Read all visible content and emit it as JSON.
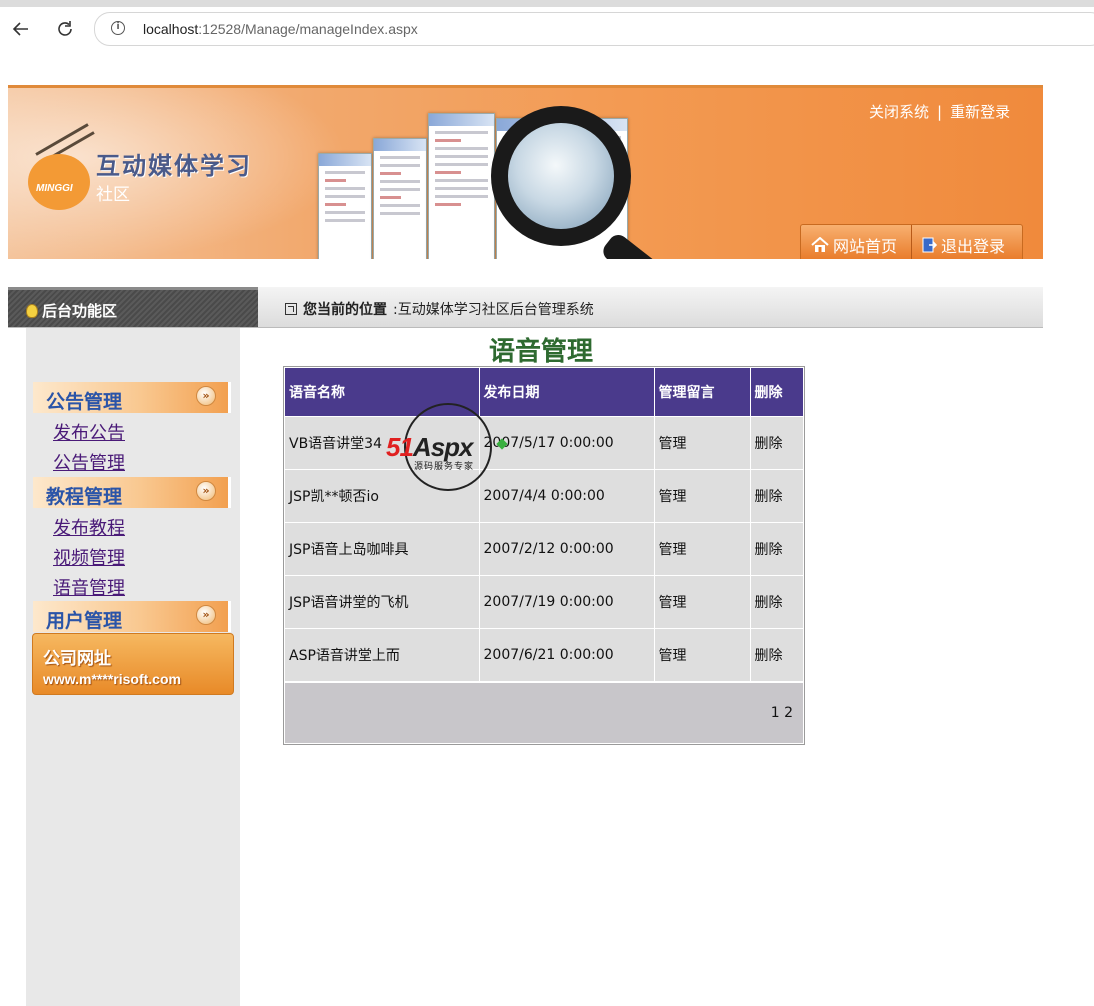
{
  "browser": {
    "url_host": "localhost",
    "url_path": ":12528/Manage/manageIndex.aspx"
  },
  "header": {
    "brand": "互动媒体学习",
    "brand_sub": "社区",
    "logo_text": "MINGGI",
    "close_system": "关闭系统",
    "divider": "|",
    "relogin": "重新登录",
    "home": "网站首页",
    "logout": "退出登录"
  },
  "funcbar": {
    "title": "后台功能区",
    "location_label": "您当前的位置",
    "location_value": ":互动媒体学习社区后台管理系统"
  },
  "sidebar": {
    "sections": [
      {
        "title": "公告管理",
        "items": [
          "发布公告",
          "公告管理"
        ]
      },
      {
        "title": "教程管理",
        "items": [
          "发布教程",
          "视频管理",
          "语音管理"
        ]
      },
      {
        "title": "用户管理",
        "items": []
      }
    ],
    "company_title": "公司网址",
    "company_url": "www.m****risoft.com"
  },
  "main": {
    "title": "语音管理",
    "columns": [
      "语音名称",
      "发布日期",
      "管理留言",
      "删除"
    ],
    "rows": [
      [
        "VB语音讲堂34",
        "2007/5/17 0:00:00",
        "管理",
        "删除"
      ],
      [
        "JSP凯**顿否io",
        "2007/4/4 0:00:00",
        "管理",
        "删除"
      ],
      [
        "JSP语音上岛咖啡具",
        "2007/2/12 0:00:00",
        "管理",
        "删除"
      ],
      [
        "JSP语音讲堂的飞机",
        "2007/7/19 0:00:00",
        "管理",
        "删除"
      ],
      [
        "ASP语音讲堂上而",
        "2007/6/21 0:00:00",
        "管理",
        "删除"
      ]
    ],
    "pager": "1 2"
  },
  "watermark": {
    "brand_red": "51",
    "brand_dark": "Aspx",
    "slogan": "源码服务专家"
  },
  "colors": {
    "table_header": "#4a3a8c",
    "sidebar_link": "#4a1a78",
    "section_title": "#2a54a8",
    "page_title": "#2e6a30"
  }
}
